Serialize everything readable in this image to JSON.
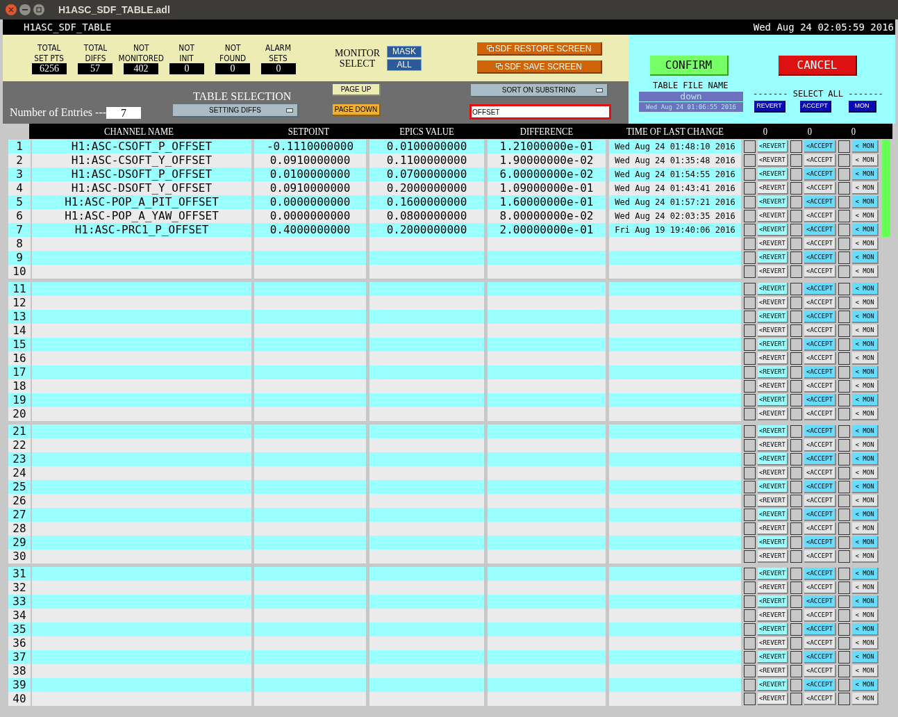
{
  "window": {
    "title": "H1ASC_SDF_TABLE.adl"
  },
  "header": {
    "screen_name": "H1ASC_SDF_TABLE",
    "datetime": "Wed Aug 24 02:05:59 2016"
  },
  "counters": [
    {
      "label": [
        "TOTAL",
        "SET PTS"
      ],
      "value": "6256"
    },
    {
      "label": [
        "TOTAL",
        "DIFFS"
      ],
      "value": "57"
    },
    {
      "label": [
        "NOT",
        "MONITORED"
      ],
      "value": "402"
    },
    {
      "label": [
        "NOT",
        "INIT"
      ],
      "value": "0"
    },
    {
      "label": [
        "NOT",
        "FOUND"
      ],
      "value": "0"
    },
    {
      "label": [
        "ALARM",
        "SETS"
      ],
      "value": "0"
    }
  ],
  "monitor_select": {
    "label": [
      "MONITOR",
      "SELECT"
    ],
    "buttons": [
      "MASK",
      "ALL"
    ]
  },
  "screen_buttons": [
    "SDF RESTORE SCREEN",
    "SDF SAVE SCREEN"
  ],
  "entries": {
    "label": "Number of Entries ---",
    "value": "7"
  },
  "table_selection": {
    "label": "TABLE SELECTION",
    "value": "SETTING DIFFS"
  },
  "paging": [
    "PAGE UP",
    "PAGE DOWN"
  ],
  "sort": {
    "value": "SORT ON SUBSTRING"
  },
  "filter": {
    "value": "OFFSET"
  },
  "confirm": "CONFIRM",
  "cancel": "CANCEL",
  "table_file": {
    "label": "TABLE FILE NAME",
    "name": "down",
    "time": "Wed Aug 24 01:06:55 2016"
  },
  "select_all": {
    "label": "------- SELECT ALL -------",
    "buttons": [
      "REVERT",
      "ACCEPT",
      "MON"
    ]
  },
  "table": {
    "columns": [
      "CHANNEL NAME",
      "SETPOINT",
      "EPICS VALUE",
      "DIFFERENCE",
      "TIME OF LAST CHANGE",
      "0",
      "0",
      "0"
    ],
    "rows": [
      {
        "number": "1",
        "channel": "H1:ASC-CSOFT_P_OFFSET",
        "setpoint": "-0.1110000000",
        "epics_value": "0.0100000000",
        "difference": "1.21000000e-01",
        "time": "Wed Aug 24 01:48:10 2016",
        "actions": [
          "<REVERT",
          "<ACCEPT",
          "< MON"
        ],
        "checked": [
          false,
          false,
          false
        ],
        "status_ok": true
      },
      {
        "number": "2",
        "channel": "H1:ASC-CSOFT_Y_OFFSET",
        "setpoint": "0.0910000000",
        "epics_value": "0.1100000000",
        "difference": "1.90000000e-02",
        "time": "Wed Aug 24 01:35:48 2016",
        "actions": [
          "<REVERT",
          "<ACCEPT",
          "< MON"
        ],
        "checked": [
          false,
          false,
          false
        ],
        "status_ok": true
      },
      {
        "number": "3",
        "channel": "H1:ASC-DSOFT_P_OFFSET",
        "setpoint": "0.0100000000",
        "epics_value": "0.0700000000",
        "difference": "6.00000000e-02",
        "time": "Wed Aug 24 01:54:55 2016",
        "actions": [
          "<REVERT",
          "<ACCEPT",
          "< MON"
        ],
        "checked": [
          false,
          false,
          false
        ],
        "status_ok": true
      },
      {
        "number": "4",
        "channel": "H1:ASC-DSOFT_Y_OFFSET",
        "setpoint": "0.0910000000",
        "epics_value": "0.2000000000",
        "difference": "1.09000000e-01",
        "time": "Wed Aug 24 01:43:41 2016",
        "actions": [
          "<REVERT",
          "<ACCEPT",
          "< MON"
        ],
        "checked": [
          false,
          false,
          false
        ],
        "status_ok": true
      },
      {
        "number": "5",
        "channel": "H1:ASC-POP_A_PIT_OFFSET",
        "setpoint": "0.0000000000",
        "epics_value": "0.1600000000",
        "difference": "1.60000000e-01",
        "time": "Wed Aug 24 01:57:21 2016",
        "actions": [
          "<REVERT",
          "<ACCEPT",
          "< MON"
        ],
        "checked": [
          false,
          false,
          false
        ],
        "status_ok": true
      },
      {
        "number": "6",
        "channel": "H1:ASC-POP_A_YAW_OFFSET",
        "setpoint": "0.0000000000",
        "epics_value": "0.0800000000",
        "difference": "8.00000000e-02",
        "time": "Wed Aug 24 02:03:35 2016",
        "actions": [
          "<REVERT",
          "<ACCEPT",
          "< MON"
        ],
        "checked": [
          false,
          false,
          false
        ],
        "status_ok": true
      },
      {
        "number": "7",
        "channel": "H1:ASC-PRC1_P_OFFSET",
        "setpoint": "0.4000000000",
        "epics_value": "0.2000000000",
        "difference": "2.00000000e-01",
        "time": "Fri Aug 19 19:40:06 2016",
        "actions": [
          "<REVERT",
          "<ACCEPT",
          "< MON"
        ],
        "checked": [
          false,
          false,
          false
        ],
        "status_ok": true
      },
      {
        "number": "8",
        "actions": [
          "<REVERT",
          "<ACCEPT",
          "< MON"
        ],
        "checked": [
          false,
          false,
          false
        ],
        "status_ok": false
      },
      {
        "number": "9",
        "actions": [
          "<REVERT",
          "<ACCEPT",
          "< MON"
        ],
        "checked": [
          false,
          false,
          false
        ],
        "status_ok": false
      },
      {
        "number": "10",
        "actions": [
          "<REVERT",
          "<ACCEPT",
          "< MON"
        ],
        "checked": [
          false,
          false,
          false
        ],
        "status_ok": false
      },
      {
        "number": "11",
        "actions": [
          "<REVERT",
          "<ACCEPT",
          "< MON"
        ],
        "checked": [
          false,
          false,
          false
        ],
        "status_ok": false
      },
      {
        "number": "12",
        "actions": [
          "<REVERT",
          "<ACCEPT",
          "< MON"
        ],
        "checked": [
          false,
          false,
          false
        ],
        "status_ok": false
      },
      {
        "number": "13",
        "actions": [
          "<REVERT",
          "<ACCEPT",
          "< MON"
        ],
        "checked": [
          false,
          false,
          false
        ],
        "status_ok": false
      },
      {
        "number": "14",
        "actions": [
          "<REVERT",
          "<ACCEPT",
          "< MON"
        ],
        "checked": [
          false,
          false,
          false
        ],
        "status_ok": false
      },
      {
        "number": "15",
        "actions": [
          "<REVERT",
          "<ACCEPT",
          "< MON"
        ],
        "checked": [
          false,
          false,
          false
        ],
        "status_ok": false
      },
      {
        "number": "16",
        "actions": [
          "<REVERT",
          "<ACCEPT",
          "< MON"
        ],
        "checked": [
          false,
          false,
          false
        ],
        "status_ok": false
      },
      {
        "number": "17",
        "actions": [
          "<REVERT",
          "<ACCEPT",
          "< MON"
        ],
        "checked": [
          false,
          false,
          false
        ],
        "status_ok": false
      },
      {
        "number": "18",
        "actions": [
          "<REVERT",
          "<ACCEPT",
          "< MON"
        ],
        "checked": [
          false,
          false,
          false
        ],
        "status_ok": false
      },
      {
        "number": "19",
        "actions": [
          "<REVERT",
          "<ACCEPT",
          "< MON"
        ],
        "checked": [
          false,
          false,
          false
        ],
        "status_ok": false
      },
      {
        "number": "20",
        "actions": [
          "<REVERT",
          "<ACCEPT",
          "< MON"
        ],
        "checked": [
          false,
          false,
          false
        ],
        "status_ok": false
      },
      {
        "number": "21",
        "actions": [
          "<REVERT",
          "<ACCEPT",
          "< MON"
        ],
        "checked": [
          false,
          false,
          false
        ],
        "status_ok": false
      },
      {
        "number": "22",
        "actions": [
          "<REVERT",
          "<ACCEPT",
          "< MON"
        ],
        "checked": [
          false,
          false,
          false
        ],
        "status_ok": false
      },
      {
        "number": "23",
        "actions": [
          "<REVERT",
          "<ACCEPT",
          "< MON"
        ],
        "checked": [
          false,
          false,
          false
        ],
        "status_ok": false
      },
      {
        "number": "24",
        "actions": [
          "<REVERT",
          "<ACCEPT",
          "< MON"
        ],
        "checked": [
          false,
          false,
          false
        ],
        "status_ok": false
      },
      {
        "number": "25",
        "actions": [
          "<REVERT",
          "<ACCEPT",
          "< MON"
        ],
        "checked": [
          false,
          false,
          false
        ],
        "status_ok": false
      },
      {
        "number": "26",
        "actions": [
          "<REVERT",
          "<ACCEPT",
          "< MON"
        ],
        "checked": [
          false,
          false,
          false
        ],
        "status_ok": false
      },
      {
        "number": "27",
        "actions": [
          "<REVERT",
          "<ACCEPT",
          "< MON"
        ],
        "checked": [
          false,
          false,
          false
        ],
        "status_ok": false
      },
      {
        "number": "28",
        "actions": [
          "<REVERT",
          "<ACCEPT",
          "< MON"
        ],
        "checked": [
          false,
          false,
          false
        ],
        "status_ok": false
      },
      {
        "number": "29",
        "actions": [
          "<REVERT",
          "<ACCEPT",
          "< MON"
        ],
        "checked": [
          false,
          false,
          false
        ],
        "status_ok": false
      },
      {
        "number": "30",
        "actions": [
          "<REVERT",
          "<ACCEPT",
          "< MON"
        ],
        "checked": [
          false,
          false,
          false
        ],
        "status_ok": false
      },
      {
        "number": "31",
        "actions": [
          "<REVERT",
          "<ACCEPT",
          "< MON"
        ],
        "checked": [
          false,
          false,
          false
        ],
        "status_ok": false
      },
      {
        "number": "32",
        "actions": [
          "<REVERT",
          "<ACCEPT",
          "< MON"
        ],
        "checked": [
          false,
          false,
          false
        ],
        "status_ok": false
      },
      {
        "number": "33",
        "actions": [
          "<REVERT",
          "<ACCEPT",
          "< MON"
        ],
        "checked": [
          false,
          false,
          false
        ],
        "status_ok": false
      },
      {
        "number": "34",
        "actions": [
          "<REVERT",
          "<ACCEPT",
          "< MON"
        ],
        "checked": [
          false,
          false,
          false
        ],
        "status_ok": false
      },
      {
        "number": "35",
        "actions": [
          "<REVERT",
          "<ACCEPT",
          "< MON"
        ],
        "checked": [
          false,
          false,
          false
        ],
        "status_ok": false
      },
      {
        "number": "36",
        "actions": [
          "<REVERT",
          "<ACCEPT",
          "< MON"
        ],
        "checked": [
          false,
          false,
          false
        ],
        "status_ok": false
      },
      {
        "number": "37",
        "actions": [
          "<REVERT",
          "<ACCEPT",
          "< MON"
        ],
        "checked": [
          false,
          false,
          false
        ],
        "status_ok": false
      },
      {
        "number": "38",
        "actions": [
          "<REVERT",
          "<ACCEPT",
          "< MON"
        ],
        "checked": [
          false,
          false,
          false
        ],
        "status_ok": false
      },
      {
        "number": "39",
        "actions": [
          "<REVERT",
          "<ACCEPT",
          "< MON"
        ],
        "checked": [
          false,
          false,
          false
        ],
        "status_ok": false
      },
      {
        "number": "40",
        "actions": [
          "<REVERT",
          "<ACCEPT",
          "< MON"
        ],
        "checked": [
          false,
          false,
          false
        ],
        "status_ok": false
      }
    ]
  }
}
